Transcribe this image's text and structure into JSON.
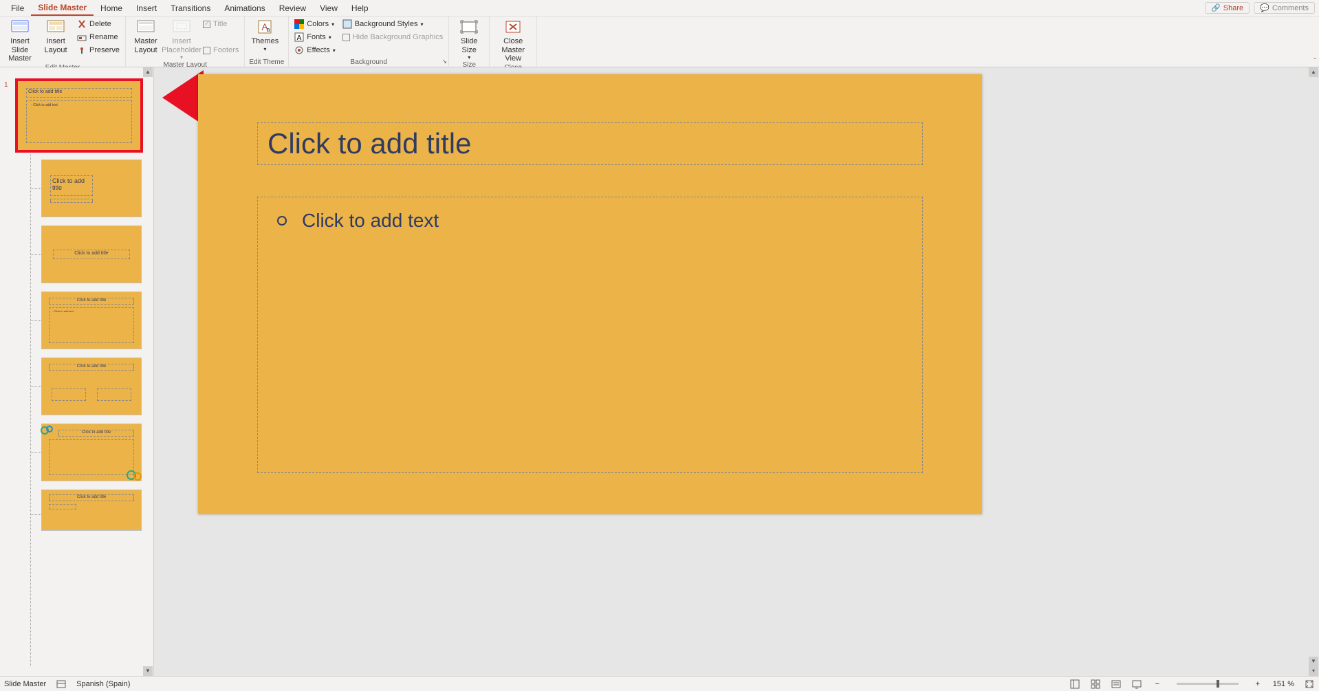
{
  "menu": {
    "tabs": [
      "File",
      "Slide Master",
      "Home",
      "Insert",
      "Transitions",
      "Animations",
      "Review",
      "View",
      "Help"
    ],
    "active": 1,
    "share": "Share",
    "comments": "Comments"
  },
  "ribbon": {
    "editMaster": {
      "insertSlideMaster": "Insert Slide\nMaster",
      "insertLayout": "Insert\nLayout",
      "delete": "Delete",
      "rename": "Rename",
      "preserve": "Preserve",
      "group": "Edit Master"
    },
    "masterLayout": {
      "masterLayout": "Master\nLayout",
      "insertPlaceholder": "Insert\nPlaceholder",
      "title": "Title",
      "footers": "Footers",
      "group": "Master Layout"
    },
    "editTheme": {
      "themes": "Themes",
      "group": "Edit Theme"
    },
    "background": {
      "colors": "Colors",
      "fonts": "Fonts",
      "effects": "Effects",
      "bgStyles": "Background Styles",
      "hideBg": "Hide Background Graphics",
      "group": "Background"
    },
    "size": {
      "slideSize": "Slide\nSize",
      "group": "Size"
    },
    "close": {
      "closeMaster": "Close\nMaster View",
      "group": "Close"
    }
  },
  "panel": {
    "masterNumber": "1",
    "master": {
      "title": "Click to add title",
      "body": "Click to add text"
    },
    "layouts": [
      {
        "title": "Click to add\ntitle",
        "sub": ""
      },
      {
        "title": "Click to add title"
      },
      {
        "title": "Click to add title",
        "body": "Click to add text"
      },
      {
        "title": "Click to add title",
        "two": true
      },
      {
        "title": "Click to add title",
        "deco": true
      },
      {
        "title": "Click to add title",
        "sub2": true
      }
    ]
  },
  "slide": {
    "titlePlaceholder": "Click to add title",
    "bodyPlaceholder": "Click to add text"
  },
  "status": {
    "mode": "Slide Master",
    "lang": "Spanish (Spain)",
    "zoom": "151 %"
  },
  "colors": {
    "slideBg": "#ecb448",
    "accent": "#b7472a",
    "highlight": "#e81123",
    "text": "#2f3b63"
  }
}
